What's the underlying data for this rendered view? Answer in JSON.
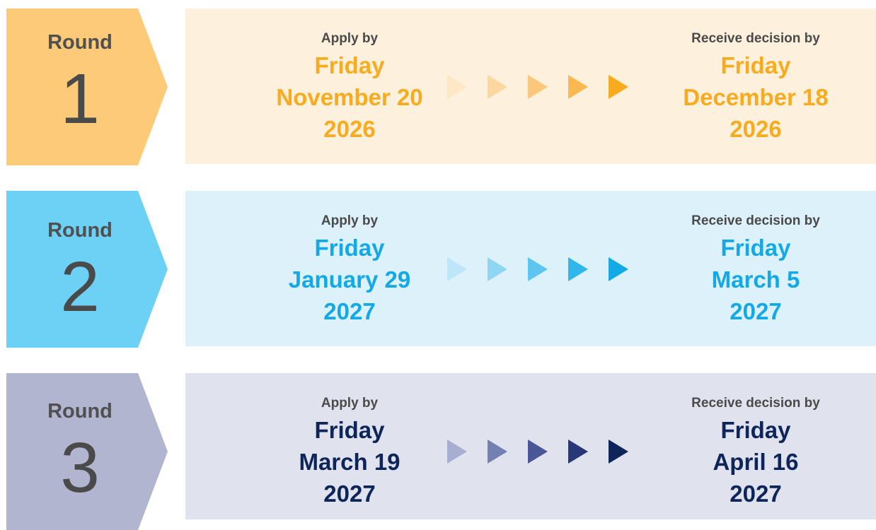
{
  "rounds": [
    {
      "label": "Round",
      "number": "1",
      "apply_label": "Apply by",
      "apply_day": "Friday",
      "apply_date": "November 20",
      "apply_year": "2026",
      "decision_label": "Receive decision by",
      "decision_day": "Friday",
      "decision_date": "December 18",
      "decision_year": "2026",
      "colors": {
        "badge": "#fdca78",
        "panel": "#fdf1de",
        "accent": "#f8ab1e",
        "arrows": [
          "#fde7c5",
          "#fcd8a0",
          "#fbc77a",
          "#f9b94e",
          "#f8ab1e"
        ]
      }
    },
    {
      "label": "Round",
      "number": "2",
      "apply_label": "Apply by",
      "apply_day": "Friday",
      "apply_date": "January 29",
      "apply_year": "2027",
      "decision_label": "Receive decision by",
      "decision_day": "Friday",
      "decision_date": "March 5",
      "decision_year": "2027",
      "colors": {
        "badge": "#6dd0f5",
        "panel": "#ddf1fb",
        "accent": "#13a9e6",
        "arrows": [
          "#bde6f8",
          "#8fd6f4",
          "#5cc6f0",
          "#2fb7eb",
          "#13a9e6"
        ]
      }
    },
    {
      "label": "Round",
      "number": "3",
      "apply_label": "Apply by",
      "apply_day": "Friday",
      "apply_date": "March 19",
      "apply_year": "2027",
      "decision_label": "Receive decision by",
      "decision_day": "Friday",
      "decision_date": "April 16",
      "decision_year": "2027",
      "colors": {
        "badge": "#b1b5d0",
        "panel": "#e0e2ee",
        "accent": "#0d2559",
        "arrows": [
          "#a7aed0",
          "#7480b2",
          "#4a5796",
          "#273778",
          "#0d2559"
        ]
      }
    }
  ]
}
